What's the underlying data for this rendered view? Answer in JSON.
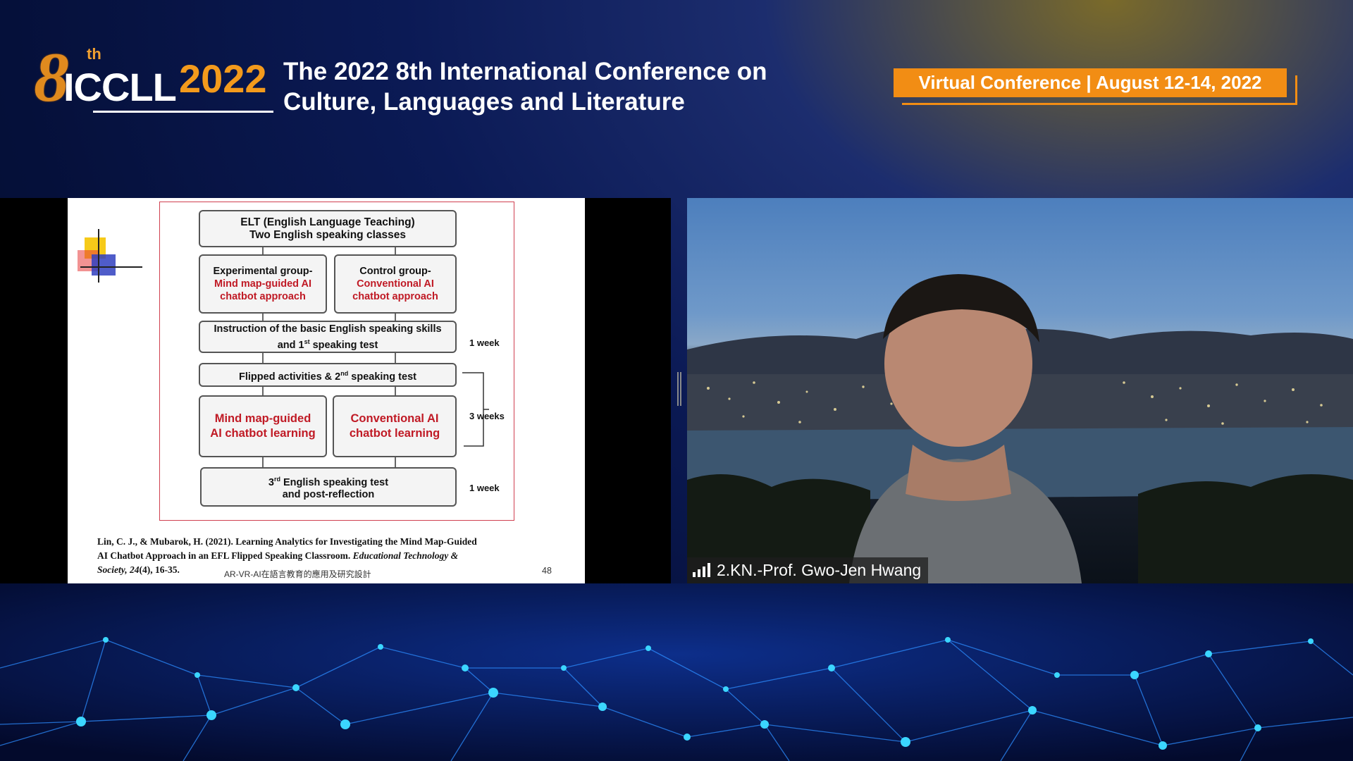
{
  "header": {
    "logo": {
      "number": "8",
      "suffix": "th",
      "acronym": "ICCLL",
      "year": "2022"
    },
    "title_line1": "The 2022 8th International Conference on",
    "title_line2": "Culture, Languages and Literature",
    "badge": "Virtual Conference | August 12-14, 2022"
  },
  "slide": {
    "box_top_line1": "ELT (English Language Teaching)",
    "box_top_line2": "Two English speaking classes",
    "exp_group_title": "Experimental group-",
    "exp_group_line2": "Mind map-guided AI",
    "exp_group_line3": "chatbot approach",
    "ctrl_group_title": "Control group-",
    "ctrl_group_line2": "Conventional AI",
    "ctrl_group_line3": "chatbot approach",
    "instruction_line1": "Instruction of the basic English speaking skills",
    "instruction_line2_pre": "and 1",
    "instruction_line2_sup": "st",
    "instruction_line2_post": " speaking test",
    "flipped_pre": "Flipped activities & 2",
    "flipped_sup": "nd",
    "flipped_post": " speaking test",
    "mindmap_line1": "Mind map-guided",
    "mindmap_line2": "AI chatbot learning",
    "conv_line1": "Conventional AI",
    "conv_line2": "chatbot learning",
    "final_line1_pre": "3",
    "final_line1_sup": "rd",
    "final_line1_post": " English speaking test",
    "final_line2": "and post-reflection",
    "week1": "1 week",
    "weeks3": "3 weeks",
    "week1b": "1 week",
    "citation_line1": "Lin, C. J., & Mubarok, H. (2021). Learning Analytics for Investigating the Mind Map-Guided",
    "citation_line2_pre": "AI Chatbot Approach in an EFL Flipped Speaking Classroom. ",
    "citation_line2_journal": "Educational Technology &",
    "citation_line3_journal": "Society, 24",
    "citation_line3_post": "(4), 16-35.",
    "footer_note": "AR-VR-AI在語言教育的應用及研究設計",
    "page_number": "48"
  },
  "video": {
    "participant_name": "2.KN.-Prof. Gwo-Jen Hwang"
  },
  "colors": {
    "accent_orange": "#f28d14",
    "slide_red": "#c01a25",
    "background_blue": "#0b1a55"
  },
  "icons": [
    "signal-strength-icon",
    "divider-handle-icon"
  ]
}
